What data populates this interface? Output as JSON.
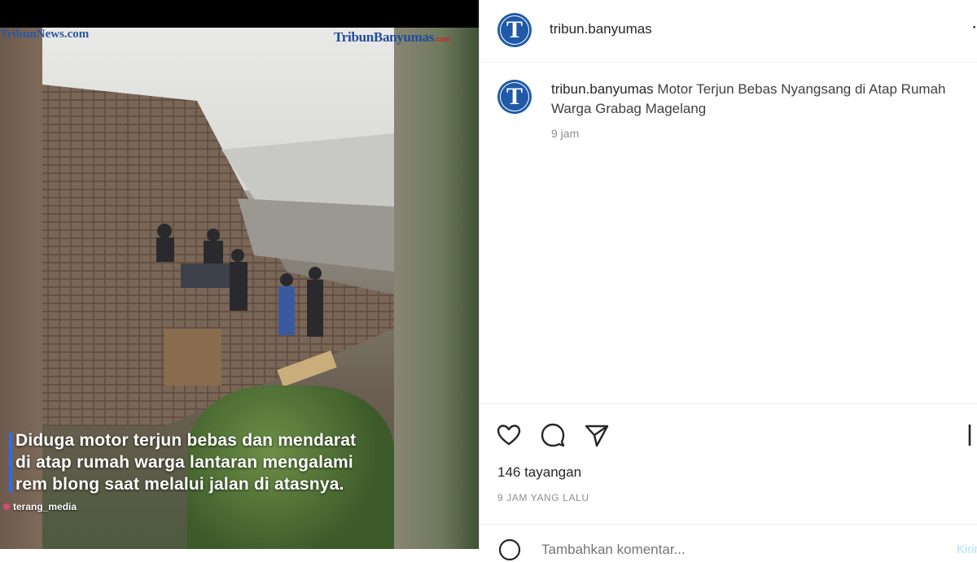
{
  "media": {
    "watermark_left": "TribunNews.com",
    "watermark_right_main": "TribunBanyumas",
    "watermark_right_suffix": ".com",
    "caption_lines": [
      "Diduga motor terjun bebas dan mendarat",
      "di atap rumah warga lantaran mengalami",
      "rem blong saat melalui jalan di atasnya."
    ],
    "credit": "terang_media"
  },
  "post": {
    "header": {
      "avatar_letter": "T",
      "username": "tribun.banyumas"
    },
    "comment": {
      "avatar_letter": "T",
      "username": "tribun.banyumas",
      "text": "Motor Terjun Bebas Nyangsang di Atap Rumah Warga Grabag Magelang",
      "time": "9 jam"
    },
    "actions": {
      "icons": [
        "heart-icon",
        "comment-icon",
        "share-icon",
        "bookmark-icon"
      ]
    },
    "views": "146 tayangan",
    "posted_ago": "9 JAM YANG LALU",
    "comment_input": {
      "placeholder": "Tambahkan komentar...",
      "post_label": "Kirim"
    }
  },
  "colors": {
    "brand_blue": "#1f59a8",
    "caption_accent": "#2f6be6",
    "muted": "#8e8e8e"
  }
}
